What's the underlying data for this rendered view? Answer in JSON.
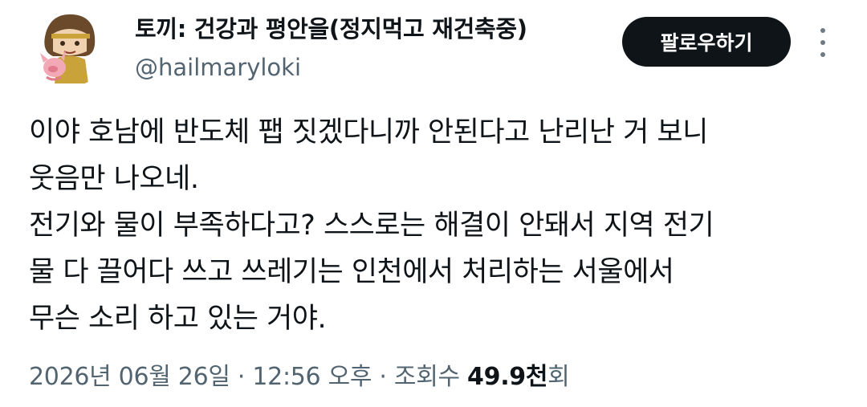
{
  "user": {
    "display_name": "토끼: 건강과 평안을(정지먹고 재건축중)",
    "handle": "@hailmaryloki"
  },
  "follow_button_label": "팔로우하기",
  "more_icon": "more-vertical-icon",
  "tweet_lines": [
    "이야 호남에 반도체 팹 짓겠다니까 안된다고 난리난 거 보니",
    "웃음만 나오네.",
    "전기와 물이 부족하다고? 스스로는 해결이 안돼서 지역 전기",
    "물 다 끌어다 쓰고 쓰레기는 인천에서 처리하는 서울에서",
    "무슨 소리 하고 있는 거야."
  ],
  "meta": {
    "date": "2026년 06월 26일",
    "separator": " · ",
    "time": "12:56 오후",
    "views_label": "조회수 ",
    "views_number": "49.9천",
    "views_suffix": "회"
  }
}
